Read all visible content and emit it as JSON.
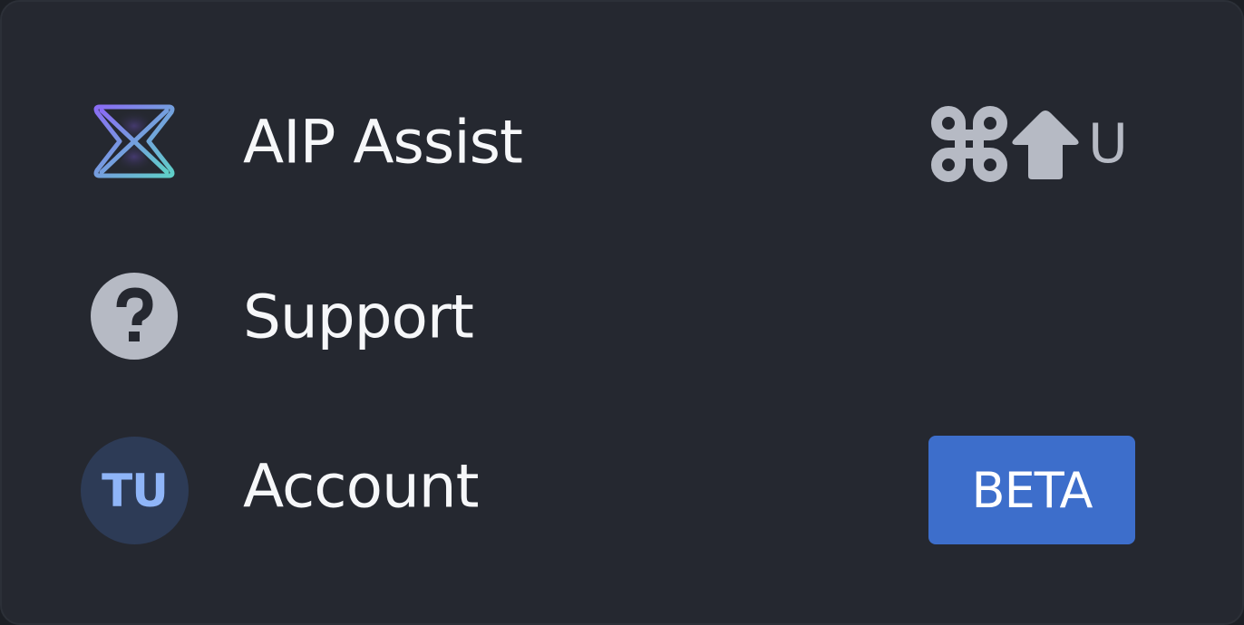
{
  "menu": {
    "items": [
      {
        "label": "AIP Assist",
        "icon": "aip-logo-icon",
        "shortcut": {
          "modifier1": "command-icon",
          "modifier2": "shift-icon",
          "key": "U"
        }
      },
      {
        "label": "Support",
        "icon": "help-circle-icon"
      },
      {
        "label": "Account",
        "avatar_initials": "TU",
        "badge": "BETA"
      }
    ]
  },
  "colors": {
    "panel_background": "#252830",
    "text": "#f6f7f9",
    "muted": "#b6bac4",
    "badge_background": "#3d6ecb",
    "avatar_background": "#2d3b56",
    "avatar_text": "#8fb5f8",
    "aip_gradient_start": "#8a6cf4",
    "aip_gradient_end": "#5fd0c8"
  }
}
